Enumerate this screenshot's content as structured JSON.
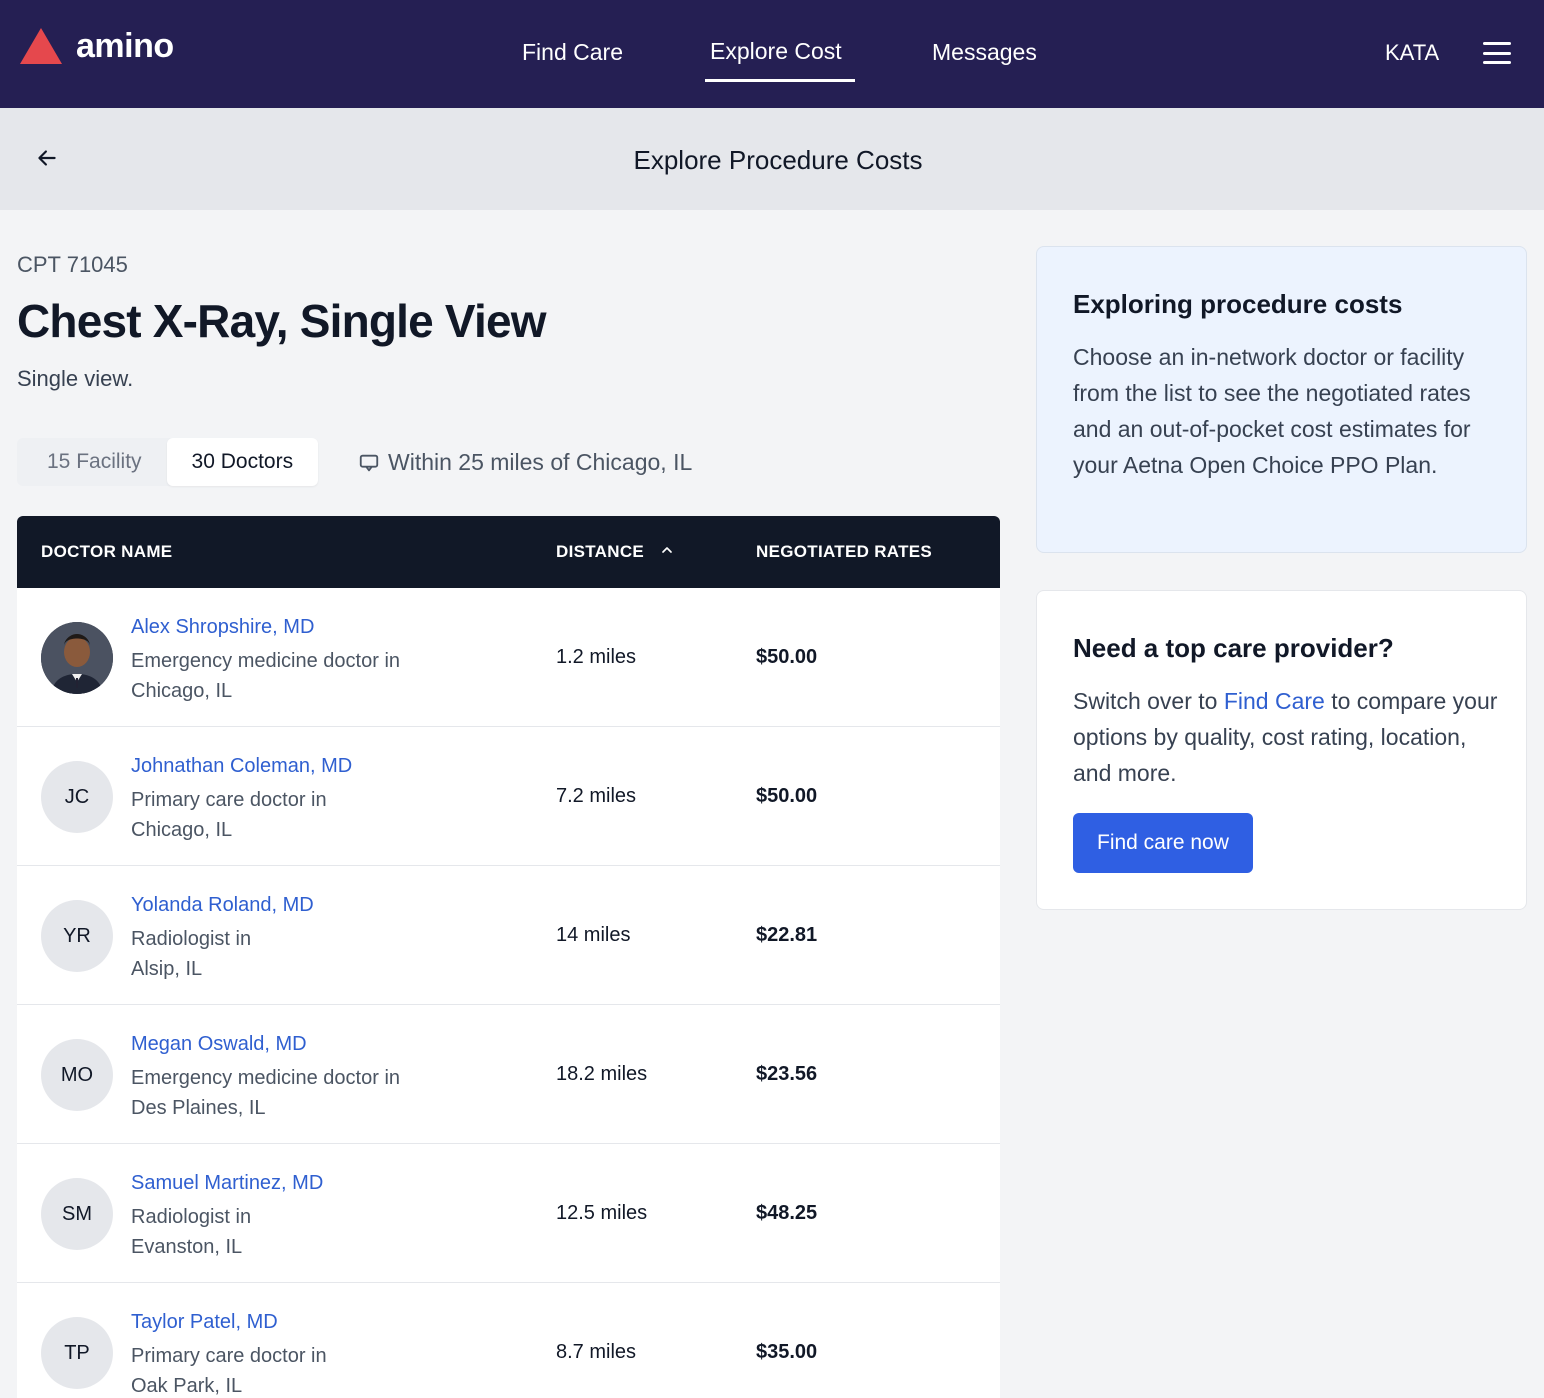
{
  "brand": {
    "name": "amino",
    "logo_color": "#e5484d"
  },
  "nav": {
    "items": [
      {
        "label": "Find Care"
      },
      {
        "label": "Explore Cost"
      },
      {
        "label": "Messages"
      }
    ],
    "active": "Explore Cost",
    "user": "KATA",
    "menu_icon": "hamburger-icon"
  },
  "subheader": {
    "title": "Explore Procedure Costs",
    "back_icon": "arrow-left-icon"
  },
  "procedure": {
    "cpt": "CPT 71045",
    "title": "Chest X-Ray, Single View",
    "subtitle": "Single view."
  },
  "tabs": [
    {
      "label": "15 Facility",
      "active": false
    },
    {
      "label": "30 Doctors",
      "active": true
    }
  ],
  "location": {
    "label": "Within 25 miles of Chicago, IL",
    "icon": "map-pin-icon"
  },
  "table": {
    "headers": {
      "name": "DOCTOR NAME",
      "distance": "DISTANCE",
      "rates": "NEGOTIATED RATES"
    },
    "sort": {
      "column": "distance",
      "direction": "ascending",
      "icon": "chevron-up-icon"
    },
    "rows": [
      {
        "initials": "",
        "photo": true,
        "name": "Alex Shropshire, MD",
        "specialty": "Emergency medicine doctor in",
        "city": "Chicago, IL",
        "distance": "1.2 miles",
        "rate": "$50.00"
      },
      {
        "initials": "JC",
        "photo": false,
        "name": "Johnathan Coleman, MD",
        "specialty": "Primary care doctor in",
        "city": "Chicago, IL",
        "distance": "7.2 miles",
        "rate": "$50.00"
      },
      {
        "initials": "YR",
        "photo": false,
        "name": "Yolanda Roland, MD",
        "specialty": "Radiologist in",
        "city": "Alsip, IL",
        "distance": "14 miles",
        "rate": "$22.81"
      },
      {
        "initials": "MO",
        "photo": false,
        "name": "Megan Oswald, MD",
        "specialty": "Emergency medicine doctor in",
        "city": "Des Plaines, IL",
        "distance": "18.2 miles",
        "rate": "$23.56"
      },
      {
        "initials": "SM",
        "photo": false,
        "name": "Samuel Martinez, MD",
        "specialty": "Radiologist in",
        "city": "Evanston, IL",
        "distance": "12.5 miles",
        "rate": "$48.25"
      },
      {
        "initials": "TP",
        "photo": false,
        "name": "Taylor Patel, MD",
        "specialty": "Primary care doctor in",
        "city": "Oak Park, IL",
        "distance": "8.7 miles",
        "rate": "$35.00"
      }
    ]
  },
  "info_card": {
    "title": "Exploring procedure costs",
    "body": "Choose an in-network doctor or facility from the list to see the negotiated rates and an out-of-pocket cost estimates for your Aetna Open Choice PPO Plan."
  },
  "provider_card": {
    "title": "Need a top care provider?",
    "body_before": "Switch over to ",
    "link": "Find Care",
    "body_after": " to compare your options by quality, cost rating, location, and more.",
    "button": "Find care now"
  },
  "colors": {
    "nav_bg": "#251f53",
    "link": "#2f5fd0",
    "button": "#2f5fe3",
    "table_header": "#111827"
  }
}
